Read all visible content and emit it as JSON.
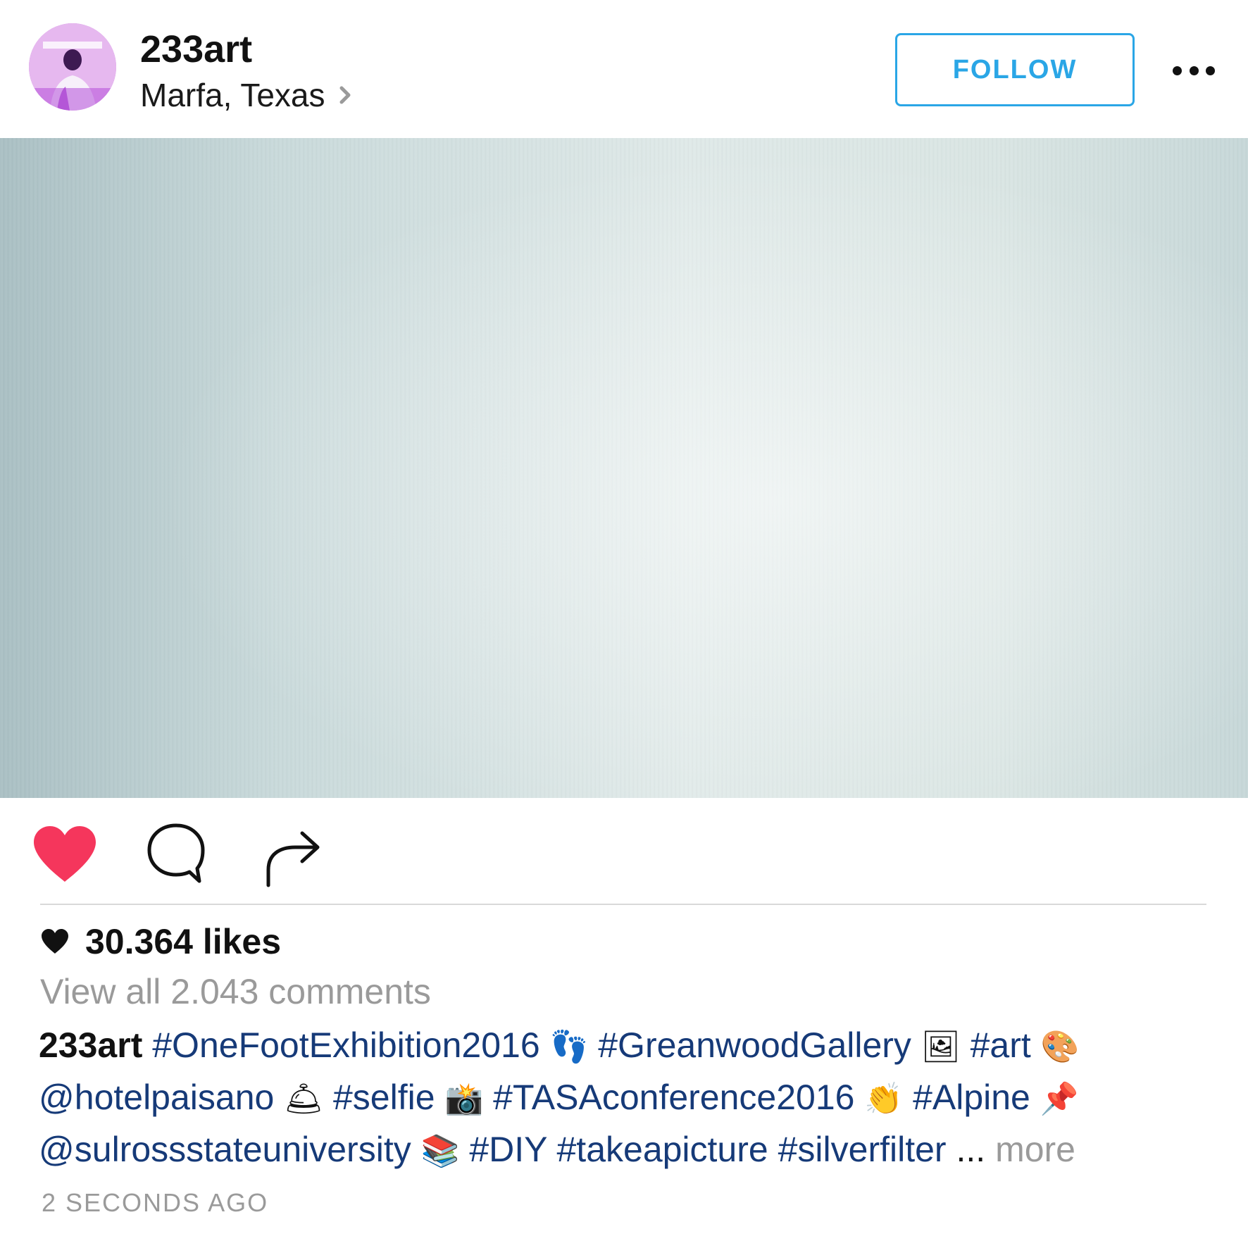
{
  "header": {
    "username": "233art",
    "location": "Marfa, Texas",
    "follow_label": "FOLLOW"
  },
  "post": {
    "likes": "30.364 likes",
    "view_comments": "View all 2.043 comments",
    "caption": {
      "owner": "233art",
      "line1": [
        {
          "kind": "tag",
          "text": "#OneFootExhibition2016"
        },
        {
          "kind": "emoji",
          "text": "👣"
        },
        {
          "kind": "tag",
          "text": "#GreanwoodGallery"
        },
        {
          "kind": "emoji",
          "text": "🖼"
        },
        {
          "kind": "tag",
          "text": "#art"
        },
        {
          "kind": "emoji",
          "text": "🎨"
        }
      ],
      "line2": [
        {
          "kind": "tag",
          "text": "@hotelpaisano"
        },
        {
          "kind": "emoji",
          "text": "🛎"
        },
        {
          "kind": "tag",
          "text": "#selfie"
        },
        {
          "kind": "emoji",
          "text": "📸"
        },
        {
          "kind": "tag",
          "text": "#TASAconference2016"
        },
        {
          "kind": "emoji",
          "text": "👏"
        },
        {
          "kind": "tag",
          "text": "#Alpine"
        },
        {
          "kind": "emoji",
          "text": "📌"
        }
      ],
      "line3": [
        {
          "kind": "tag",
          "text": "@sulrossstateuniversity"
        },
        {
          "kind": "emoji",
          "text": "📚"
        },
        {
          "kind": "tag",
          "text": "#DIY"
        },
        {
          "kind": "tag",
          "text": "#takeapicture"
        },
        {
          "kind": "tag",
          "text": "#silverfilter"
        }
      ],
      "ellipsis": "...",
      "more_label": "more"
    },
    "timestamp": "2 SECONDS AGO"
  },
  "colors": {
    "accent_blue": "#2aa6e6",
    "hashtag_blue": "#163a78",
    "like_red": "#f5365c",
    "muted_gray": "#9a9a9a"
  },
  "icons": {
    "like": "heart-icon",
    "comment": "comment-bubble-icon",
    "share": "share-arrow-icon",
    "more": "more-options-icon",
    "location_chevron": "chevron-right-icon",
    "likes_heart": "small-heart-icon"
  }
}
